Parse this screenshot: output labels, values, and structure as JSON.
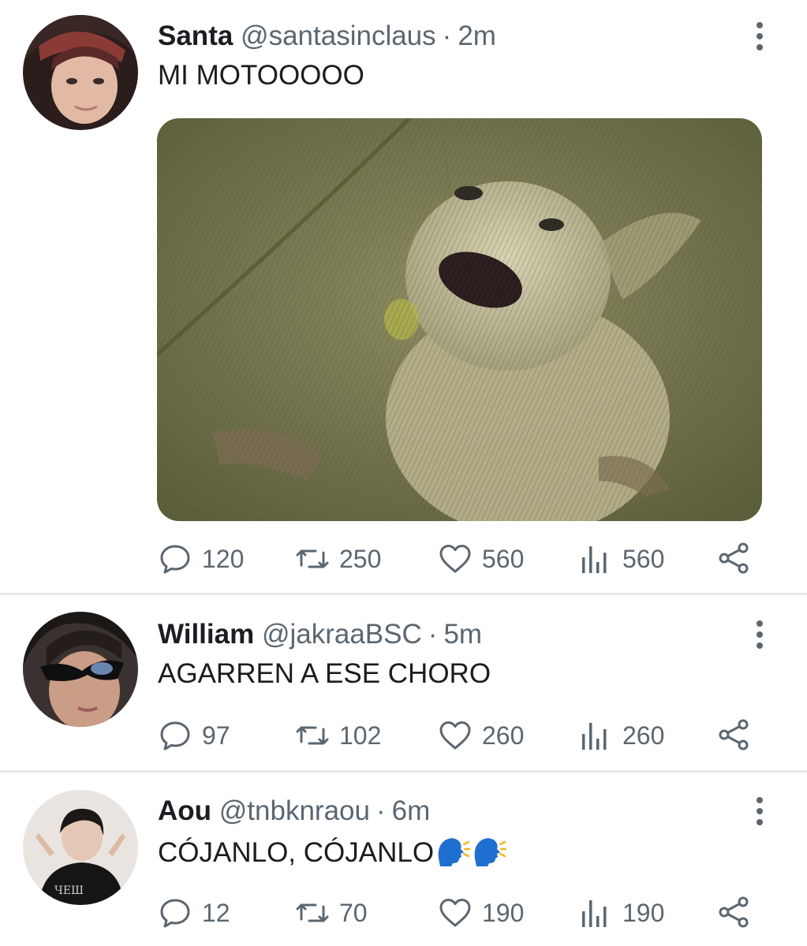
{
  "tweets": [
    {
      "name": "Santa",
      "handle": "@santasinclaus",
      "separator": "·",
      "time": "2m",
      "text": "MI MOTOOOOO",
      "replies": "120",
      "retweets": "250",
      "likes": "560",
      "views": "560",
      "has_media": true
    },
    {
      "name": "William",
      "handle": "@jakraaBSC",
      "separator": "·",
      "time": "5m",
      "text": "AGARREN A ESE CHORO",
      "replies": "97",
      "retweets": "102",
      "likes": "260",
      "views": "260"
    },
    {
      "name": "Aou",
      "handle": "@tnbknraou",
      "separator": "·",
      "time": "6m",
      "text": "CÓJANLO, CÓJANLO",
      "text_emoji": [
        "speaking-head-emoji",
        "speaking-head-emoji"
      ],
      "replies": "12",
      "retweets": "70",
      "likes": "190",
      "views": "190"
    }
  ],
  "icons": {
    "reply": "speech-bubble-icon",
    "retweet": "retweet-arrows-icon",
    "like": "heart-icon",
    "views": "bar-chart-icon",
    "share": "share-nodes-icon",
    "more": "vertical-dots-icon"
  },
  "colors": {
    "text": "#1a1d21",
    "muted": "#5b6670",
    "divider": "#e6e8eb",
    "emoji_blue": "#1f6fd1",
    "emoji_yellow": "#f2b51c"
  }
}
